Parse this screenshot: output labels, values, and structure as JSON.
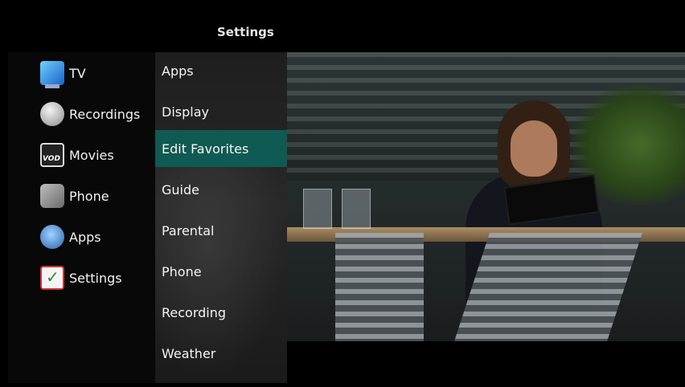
{
  "header": {
    "title": "Settings"
  },
  "main_menu": [
    {
      "label": "TV",
      "icon": "tv-icon"
    },
    {
      "label": "Recordings",
      "icon": "recordings-film-reel-icon"
    },
    {
      "label": "Movies",
      "icon": "vod-clapperboard-icon"
    },
    {
      "label": "Phone",
      "icon": "phone-icon"
    },
    {
      "label": "Apps",
      "icon": "apps-gear-icon"
    },
    {
      "label": "Settings",
      "icon": "settings-checkbox-icon"
    }
  ],
  "submenu": {
    "selected_index": 2,
    "items": [
      {
        "label": "Apps"
      },
      {
        "label": "Display"
      },
      {
        "label": "Edit Favorites"
      },
      {
        "label": "Guide"
      },
      {
        "label": "Parental"
      },
      {
        "label": "Phone"
      },
      {
        "label": "Recording"
      },
      {
        "label": "Weather"
      }
    ]
  },
  "colors": {
    "highlight": "#0f5a52",
    "background": "#000000",
    "text": "#ffffff"
  }
}
